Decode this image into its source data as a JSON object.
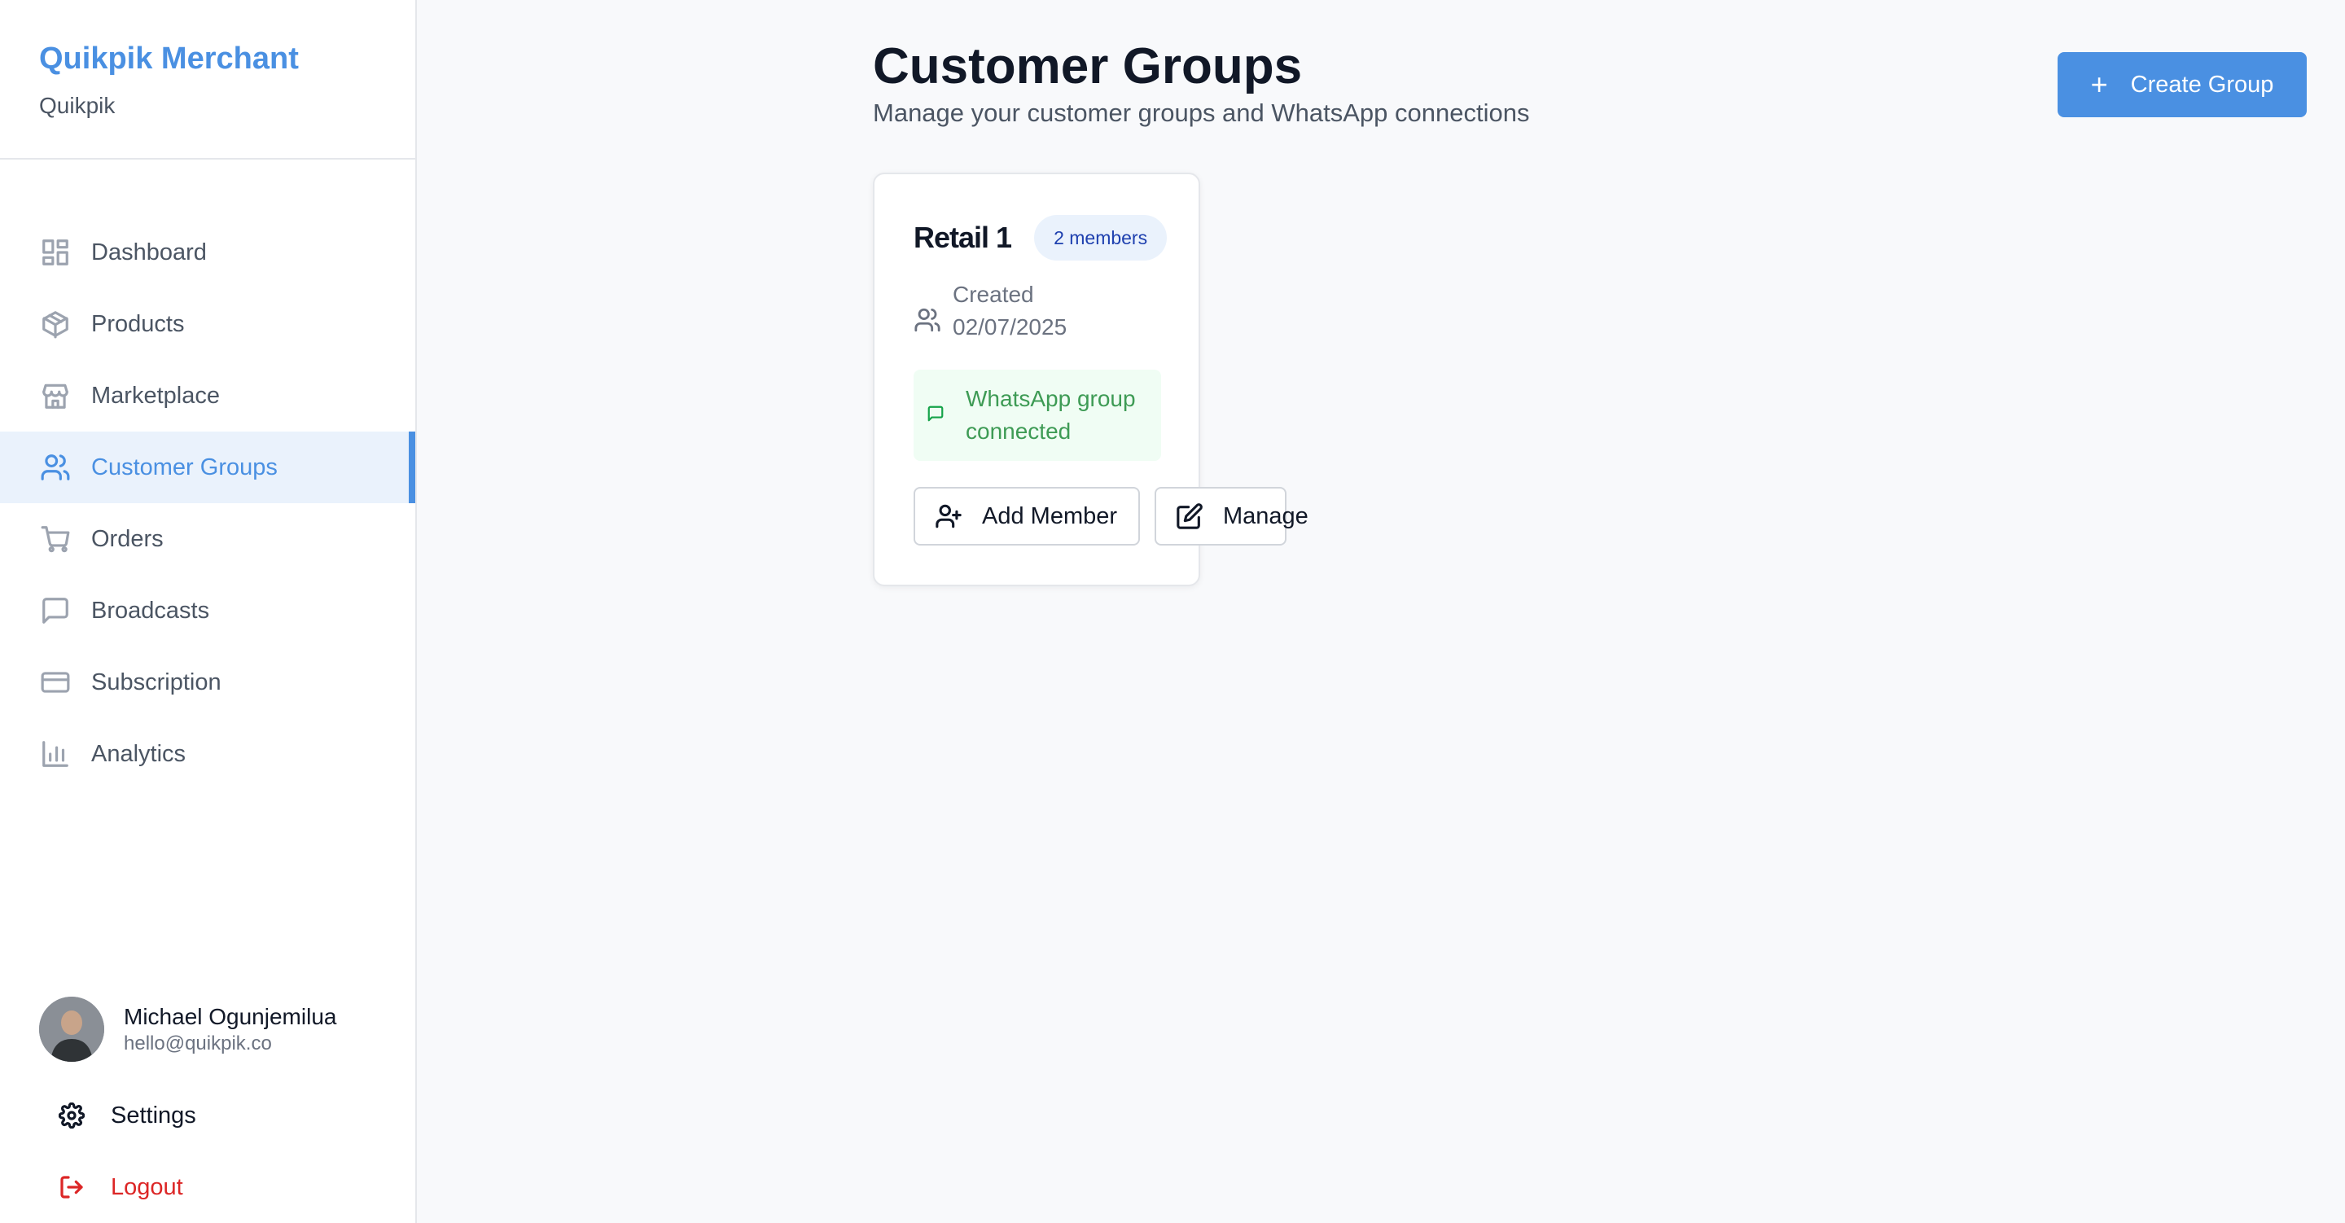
{
  "brand": {
    "title": "Quikpik Merchant",
    "subtitle": "Quikpik"
  },
  "sidebar": {
    "items": [
      {
        "label": "Dashboard",
        "icon": "dashboard-icon"
      },
      {
        "label": "Products",
        "icon": "package-icon"
      },
      {
        "label": "Marketplace",
        "icon": "store-icon"
      },
      {
        "label": "Customer Groups",
        "icon": "users-icon",
        "active": true
      },
      {
        "label": "Orders",
        "icon": "cart-icon"
      },
      {
        "label": "Broadcasts",
        "icon": "message-icon"
      },
      {
        "label": "Subscription",
        "icon": "credit-card-icon"
      },
      {
        "label": "Analytics",
        "icon": "bar-chart-icon"
      }
    ]
  },
  "user": {
    "name": "Michael Ogunjemilua",
    "email": "hello@quikpik.co"
  },
  "bottom": {
    "settings_label": "Settings",
    "logout_label": "Logout"
  },
  "page": {
    "title": "Customer Groups",
    "subtitle": "Manage your customer groups and WhatsApp connections",
    "create_label": "Create Group"
  },
  "group_card": {
    "title": "Retail 1",
    "members_badge": "2 members",
    "created_text": "Created 02/07/2025",
    "whatsapp_status": "WhatsApp group connected",
    "add_member_label": "Add Member",
    "manage_label": "Manage"
  },
  "colors": {
    "accent": "#4a90e2",
    "active_bg": "#eaf2fc",
    "success_text": "#3e9b55",
    "success_bg": "#f0fdf4",
    "danger": "#dc2626"
  }
}
